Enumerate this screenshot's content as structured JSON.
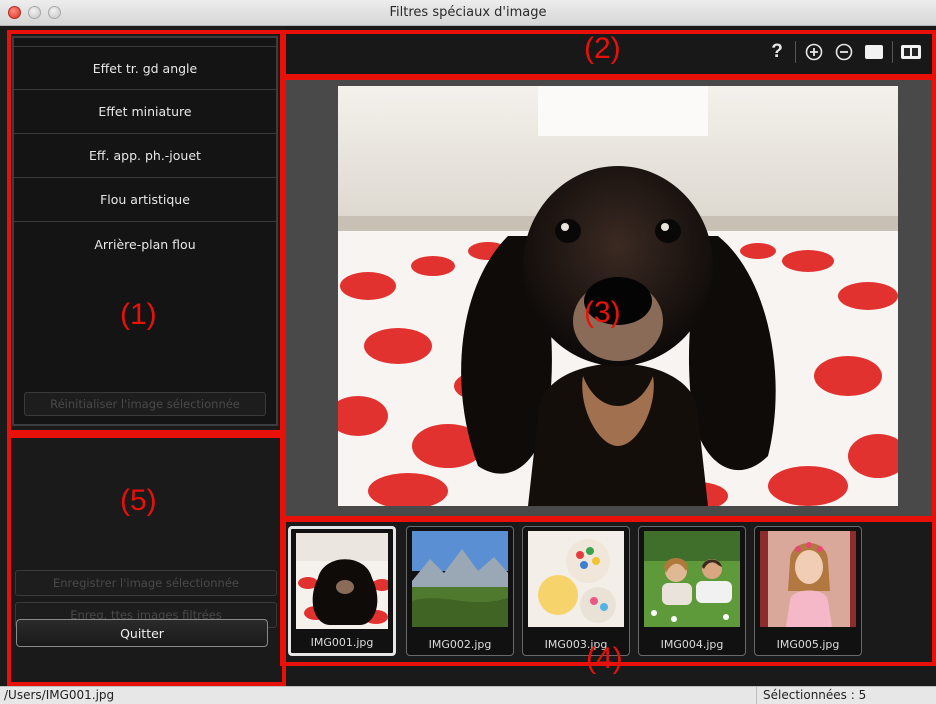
{
  "window": {
    "title": "Filtres spéciaux d'image"
  },
  "filters": [
    {
      "label": "Effet tr. gd angle"
    },
    {
      "label": "Effet miniature"
    },
    {
      "label": "Eff. app. ph.-jouet"
    },
    {
      "label": "Flou artistique"
    },
    {
      "label": "Arrière-plan flou"
    }
  ],
  "left_panel": {
    "reset_label": "Réinitialiser l'image sélectionnée",
    "save_selected_label": "Enregistrer l'image sélectionnée",
    "save_all_label": "Enreg. ttes images filtrées",
    "quit_label": "Quitter"
  },
  "toolbar": {
    "icons": [
      "help-icon",
      "zoom-in-icon",
      "zoom-out-icon",
      "single-view-icon",
      "dual-view-icon"
    ],
    "help_glyph": "?"
  },
  "thumbnails": [
    {
      "name": "IMG001.jpg",
      "selected": true
    },
    {
      "name": "IMG002.jpg",
      "selected": false
    },
    {
      "name": "IMG003.jpg",
      "selected": false
    },
    {
      "name": "IMG004.jpg",
      "selected": false
    },
    {
      "name": "IMG005.jpg",
      "selected": false
    }
  ],
  "status": {
    "path": "/Users/IMG001.jpg",
    "selected_count": "Sélectionnées : 5"
  },
  "callouts": {
    "c1": "(1)",
    "c2": "(2)",
    "c3": "(3)",
    "c4": "(4)",
    "c5": "(5)"
  },
  "colors": {
    "callout": "#e8110a",
    "panel": "#1a1a1a",
    "preview_bg": "#494949"
  }
}
